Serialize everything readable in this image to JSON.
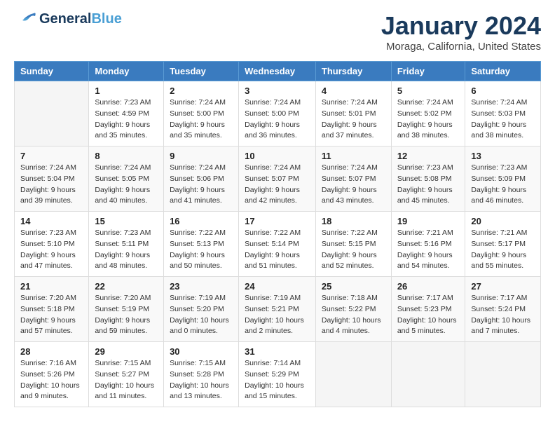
{
  "header": {
    "logo_general": "General",
    "logo_blue": "Blue",
    "month_year": "January 2024",
    "location": "Moraga, California, United States"
  },
  "columns": [
    "Sunday",
    "Monday",
    "Tuesday",
    "Wednesday",
    "Thursday",
    "Friday",
    "Saturday"
  ],
  "weeks": [
    [
      {
        "day": "",
        "sunrise": "",
        "sunset": "",
        "daylight": ""
      },
      {
        "day": "1",
        "sunrise": "Sunrise: 7:23 AM",
        "sunset": "Sunset: 4:59 PM",
        "daylight": "Daylight: 9 hours and 35 minutes."
      },
      {
        "day": "2",
        "sunrise": "Sunrise: 7:24 AM",
        "sunset": "Sunset: 5:00 PM",
        "daylight": "Daylight: 9 hours and 35 minutes."
      },
      {
        "day": "3",
        "sunrise": "Sunrise: 7:24 AM",
        "sunset": "Sunset: 5:00 PM",
        "daylight": "Daylight: 9 hours and 36 minutes."
      },
      {
        "day": "4",
        "sunrise": "Sunrise: 7:24 AM",
        "sunset": "Sunset: 5:01 PM",
        "daylight": "Daylight: 9 hours and 37 minutes."
      },
      {
        "day": "5",
        "sunrise": "Sunrise: 7:24 AM",
        "sunset": "Sunset: 5:02 PM",
        "daylight": "Daylight: 9 hours and 38 minutes."
      },
      {
        "day": "6",
        "sunrise": "Sunrise: 7:24 AM",
        "sunset": "Sunset: 5:03 PM",
        "daylight": "Daylight: 9 hours and 38 minutes."
      }
    ],
    [
      {
        "day": "7",
        "sunrise": "Sunrise: 7:24 AM",
        "sunset": "Sunset: 5:04 PM",
        "daylight": "Daylight: 9 hours and 39 minutes."
      },
      {
        "day": "8",
        "sunrise": "Sunrise: 7:24 AM",
        "sunset": "Sunset: 5:05 PM",
        "daylight": "Daylight: 9 hours and 40 minutes."
      },
      {
        "day": "9",
        "sunrise": "Sunrise: 7:24 AM",
        "sunset": "Sunset: 5:06 PM",
        "daylight": "Daylight: 9 hours and 41 minutes."
      },
      {
        "day": "10",
        "sunrise": "Sunrise: 7:24 AM",
        "sunset": "Sunset: 5:07 PM",
        "daylight": "Daylight: 9 hours and 42 minutes."
      },
      {
        "day": "11",
        "sunrise": "Sunrise: 7:24 AM",
        "sunset": "Sunset: 5:07 PM",
        "daylight": "Daylight: 9 hours and 43 minutes."
      },
      {
        "day": "12",
        "sunrise": "Sunrise: 7:23 AM",
        "sunset": "Sunset: 5:08 PM",
        "daylight": "Daylight: 9 hours and 45 minutes."
      },
      {
        "day": "13",
        "sunrise": "Sunrise: 7:23 AM",
        "sunset": "Sunset: 5:09 PM",
        "daylight": "Daylight: 9 hours and 46 minutes."
      }
    ],
    [
      {
        "day": "14",
        "sunrise": "Sunrise: 7:23 AM",
        "sunset": "Sunset: 5:10 PM",
        "daylight": "Daylight: 9 hours and 47 minutes."
      },
      {
        "day": "15",
        "sunrise": "Sunrise: 7:23 AM",
        "sunset": "Sunset: 5:11 PM",
        "daylight": "Daylight: 9 hours and 48 minutes."
      },
      {
        "day": "16",
        "sunrise": "Sunrise: 7:22 AM",
        "sunset": "Sunset: 5:13 PM",
        "daylight": "Daylight: 9 hours and 50 minutes."
      },
      {
        "day": "17",
        "sunrise": "Sunrise: 7:22 AM",
        "sunset": "Sunset: 5:14 PM",
        "daylight": "Daylight: 9 hours and 51 minutes."
      },
      {
        "day": "18",
        "sunrise": "Sunrise: 7:22 AM",
        "sunset": "Sunset: 5:15 PM",
        "daylight": "Daylight: 9 hours and 52 minutes."
      },
      {
        "day": "19",
        "sunrise": "Sunrise: 7:21 AM",
        "sunset": "Sunset: 5:16 PM",
        "daylight": "Daylight: 9 hours and 54 minutes."
      },
      {
        "day": "20",
        "sunrise": "Sunrise: 7:21 AM",
        "sunset": "Sunset: 5:17 PM",
        "daylight": "Daylight: 9 hours and 55 minutes."
      }
    ],
    [
      {
        "day": "21",
        "sunrise": "Sunrise: 7:20 AM",
        "sunset": "Sunset: 5:18 PM",
        "daylight": "Daylight: 9 hours and 57 minutes."
      },
      {
        "day": "22",
        "sunrise": "Sunrise: 7:20 AM",
        "sunset": "Sunset: 5:19 PM",
        "daylight": "Daylight: 9 hours and 59 minutes."
      },
      {
        "day": "23",
        "sunrise": "Sunrise: 7:19 AM",
        "sunset": "Sunset: 5:20 PM",
        "daylight": "Daylight: 10 hours and 0 minutes."
      },
      {
        "day": "24",
        "sunrise": "Sunrise: 7:19 AM",
        "sunset": "Sunset: 5:21 PM",
        "daylight": "Daylight: 10 hours and 2 minutes."
      },
      {
        "day": "25",
        "sunrise": "Sunrise: 7:18 AM",
        "sunset": "Sunset: 5:22 PM",
        "daylight": "Daylight: 10 hours and 4 minutes."
      },
      {
        "day": "26",
        "sunrise": "Sunrise: 7:17 AM",
        "sunset": "Sunset: 5:23 PM",
        "daylight": "Daylight: 10 hours and 5 minutes."
      },
      {
        "day": "27",
        "sunrise": "Sunrise: 7:17 AM",
        "sunset": "Sunset: 5:24 PM",
        "daylight": "Daylight: 10 hours and 7 minutes."
      }
    ],
    [
      {
        "day": "28",
        "sunrise": "Sunrise: 7:16 AM",
        "sunset": "Sunset: 5:26 PM",
        "daylight": "Daylight: 10 hours and 9 minutes."
      },
      {
        "day": "29",
        "sunrise": "Sunrise: 7:15 AM",
        "sunset": "Sunset: 5:27 PM",
        "daylight": "Daylight: 10 hours and 11 minutes."
      },
      {
        "day": "30",
        "sunrise": "Sunrise: 7:15 AM",
        "sunset": "Sunset: 5:28 PM",
        "daylight": "Daylight: 10 hours and 13 minutes."
      },
      {
        "day": "31",
        "sunrise": "Sunrise: 7:14 AM",
        "sunset": "Sunset: 5:29 PM",
        "daylight": "Daylight: 10 hours and 15 minutes."
      },
      {
        "day": "",
        "sunrise": "",
        "sunset": "",
        "daylight": ""
      },
      {
        "day": "",
        "sunrise": "",
        "sunset": "",
        "daylight": ""
      },
      {
        "day": "",
        "sunrise": "",
        "sunset": "",
        "daylight": ""
      }
    ]
  ]
}
